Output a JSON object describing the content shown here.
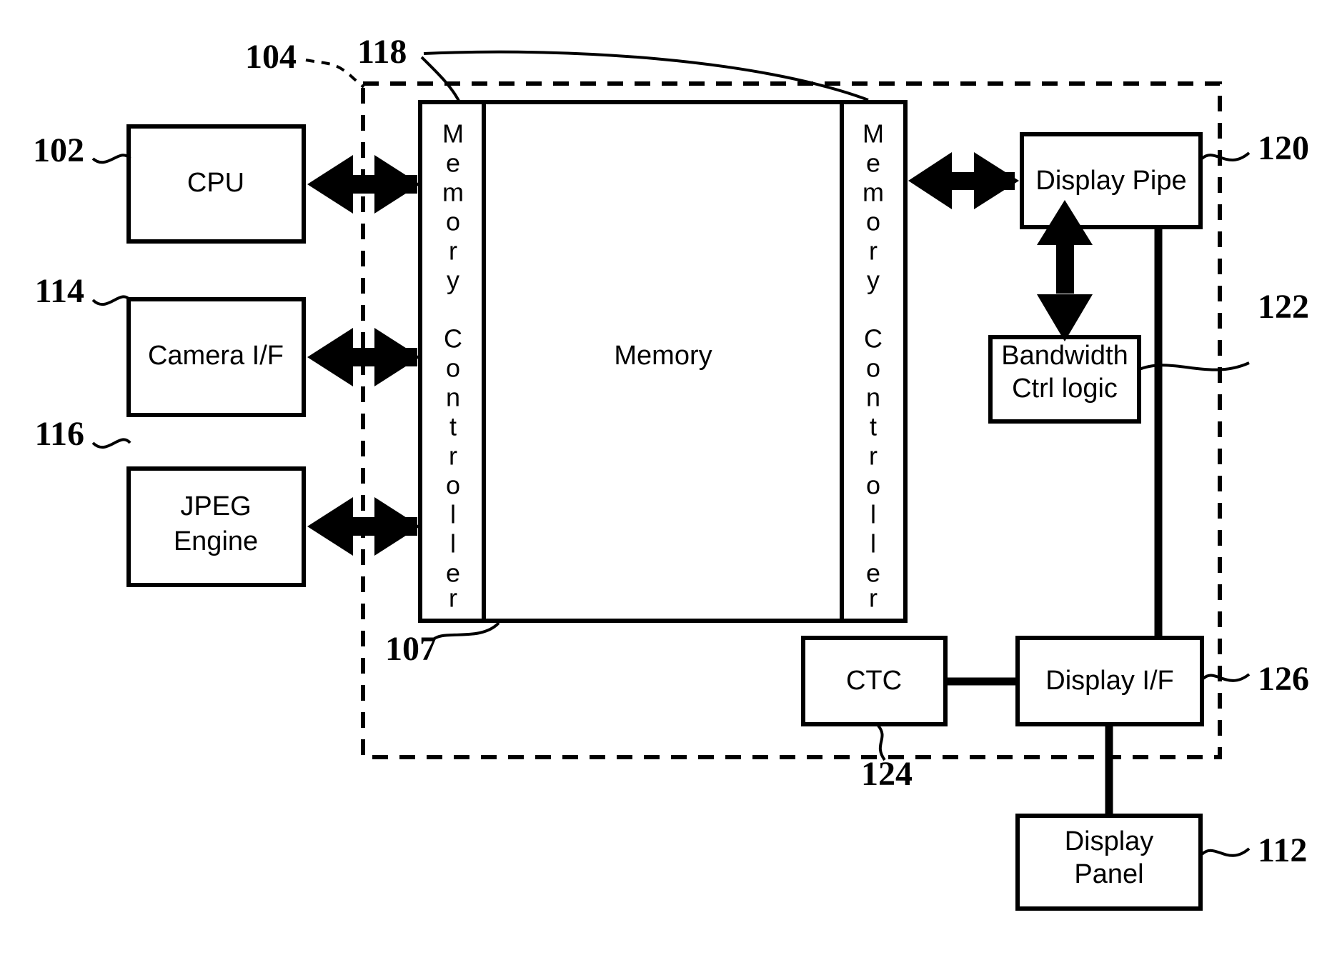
{
  "figure": {
    "type": "patent-block-diagram",
    "background": "#ffffff",
    "stroke_color": "#000000"
  },
  "blocks": {
    "cpu": {
      "label": "CPU"
    },
    "camera_if": {
      "label": "Camera I/F"
    },
    "jpeg_engine": {
      "label_line1": "JPEG",
      "label_line2": "Engine"
    },
    "memory_ctrl_left": {
      "label": "Memory Controller"
    },
    "memory": {
      "label": "Memory"
    },
    "memory_ctrl_right": {
      "label": "Memory Controller"
    },
    "display_pipe": {
      "label": "Display Pipe"
    },
    "bandwidth_ctrl": {
      "label_line1": "Bandwidth",
      "label_line2": "Ctrl logic"
    },
    "ctc": {
      "label": "CTC"
    },
    "display_if": {
      "label": "Display I/F"
    },
    "display_panel": {
      "label_line1": "Display",
      "label_line2": "Panel"
    }
  },
  "reference_numerals": {
    "soc_boundary": "104",
    "cpu": "102",
    "camera_if": "114",
    "jpeg_engine": "116",
    "memory_controllers": "118",
    "memory_subsystem": "107",
    "display_pipe": "120",
    "bandwidth_ctrl": "122",
    "ctc": "124",
    "display_if": "126",
    "display_panel": "112"
  },
  "vertical_letters": {
    "memory_controller": [
      "M",
      "e",
      "m",
      "o",
      "r",
      "y",
      "",
      "C",
      "o",
      "n",
      "t",
      "r",
      "o",
      "l",
      "l",
      "e",
      "r"
    ]
  }
}
